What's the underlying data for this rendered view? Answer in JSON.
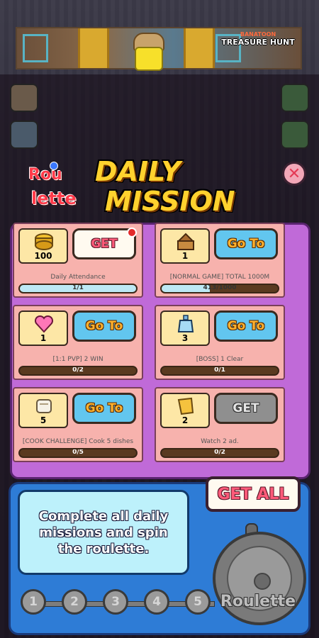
{
  "banner": {
    "brand": "BANATOON",
    "title": "TREASURE HUNT"
  },
  "header": {
    "roulette_top": "Rou",
    "roulette_bottom": "lette",
    "title_line1": "DAILY",
    "title_line2": "MISSION"
  },
  "missions": [
    {
      "icon": "coin-stack-icon",
      "count": "100",
      "button": "GET",
      "button_state": "get",
      "notification": true,
      "description": "Daily Attendance",
      "progress_text": "1/1",
      "progress": 1.0
    },
    {
      "icon": "treasure-chest-icon",
      "count": "1",
      "button": "Go To",
      "button_state": "goto",
      "notification": false,
      "description": "[NORMAL GAME] TOTAL 1000M",
      "progress_text": "413/1000",
      "progress": 0.413
    },
    {
      "icon": "pink-heart-icon",
      "count": "1",
      "button": "Go To",
      "button_state": "goto",
      "notification": false,
      "description": "[1:1 PVP] 2 WIN",
      "progress_text": "0/2",
      "progress": 0
    },
    {
      "icon": "blue-potion-icon",
      "count": "3",
      "button": "Go To",
      "button_state": "goto",
      "notification": false,
      "description": "[BOSS] 1 Clear",
      "progress_text": "0/1",
      "progress": 0
    },
    {
      "icon": "scroll-icon",
      "count": "5",
      "button": "Go To",
      "button_state": "goto",
      "notification": false,
      "description": "[COOK CHALLENGE] Cook 5 dishes",
      "progress_text": "0/5",
      "progress": 0
    },
    {
      "icon": "gold-ticket-icon",
      "count": "2",
      "button": "GET",
      "button_state": "disabled",
      "notification": false,
      "description": "Watch 2 ad.",
      "progress_text": "0/2",
      "progress": 0
    }
  ],
  "get_all_label": "GET ALL",
  "bottom": {
    "message": "Complete all daily missions and spin the roulette.",
    "steps": [
      "1",
      "2",
      "3",
      "4",
      "5"
    ],
    "wheel_label": "Roulette"
  },
  "colors": {
    "panel": "#c06ad8",
    "card": "#f7b2ad",
    "goto_button": "#62c6ef",
    "title": "#ffd22e",
    "bottom_panel": "#2e7cd6"
  }
}
